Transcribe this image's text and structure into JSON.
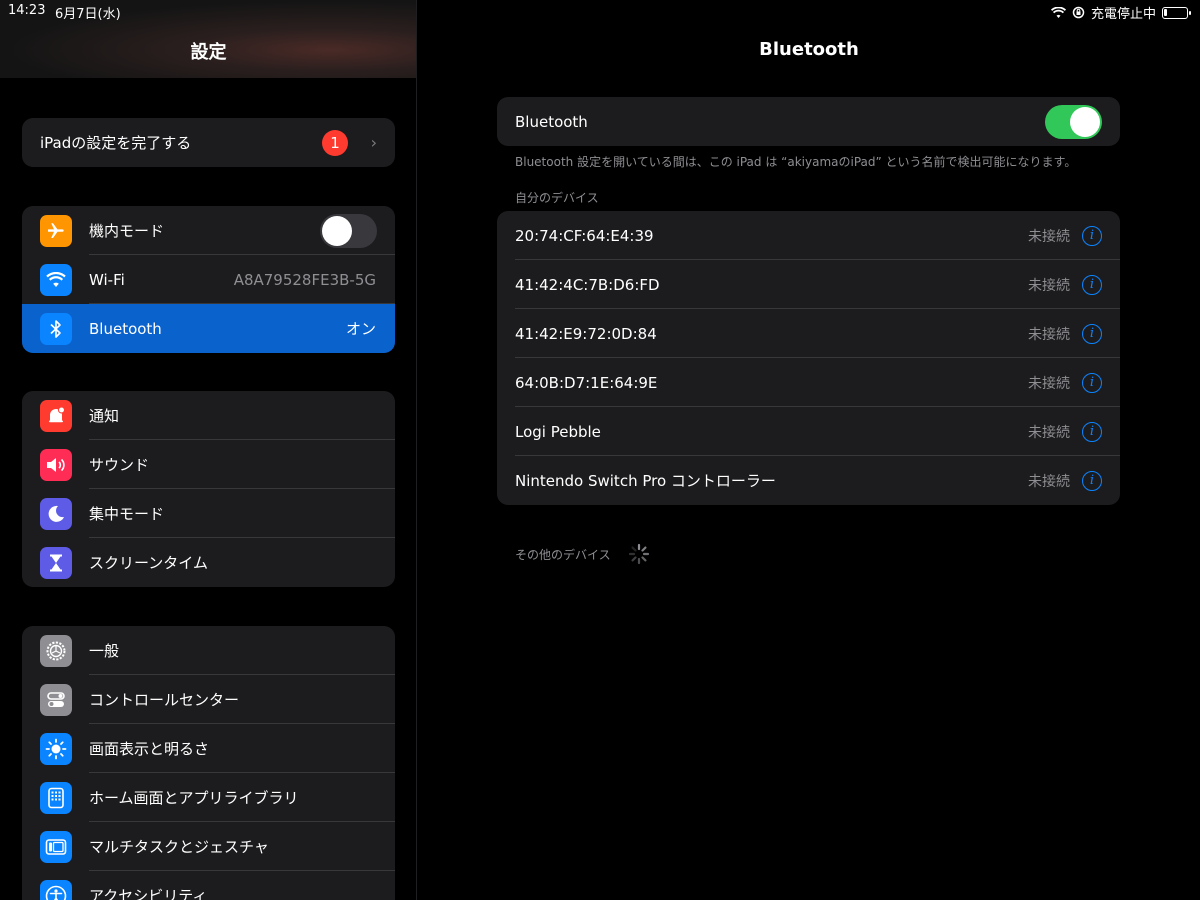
{
  "status_bar": {
    "time": "14:23",
    "date": "6月7日(水)",
    "charging_text": "充電停止中",
    "icons": [
      "wifi-icon",
      "lock-rotation-icon",
      "battery-icon"
    ]
  },
  "sidebar": {
    "title": "設定",
    "setup": {
      "label": "iPadの設定を完了する",
      "badge": "1"
    },
    "connectivity": [
      {
        "label": "機内モード",
        "icon": "airplane-icon",
        "icon_color": "#ff9500",
        "toggle": false
      },
      {
        "label": "Wi-Fi",
        "icon": "wifi-icon",
        "icon_color": "#0a84ff",
        "value": "A8A79528FE3B-5G"
      },
      {
        "label": "Bluetooth",
        "icon": "bluetooth-icon",
        "icon_color": "#0a84ff",
        "value": "オン",
        "selected": true
      }
    ],
    "notifications": [
      {
        "label": "通知",
        "icon": "bell-icon",
        "icon_color": "#ff3b30"
      },
      {
        "label": "サウンド",
        "icon": "speaker-icon",
        "icon_color": "#ff2d55"
      },
      {
        "label": "集中モード",
        "icon": "moon-icon",
        "icon_color": "#5e5ce6"
      },
      {
        "label": "スクリーンタイム",
        "icon": "hourglass-icon",
        "icon_color": "#5e5ce6"
      }
    ],
    "general": [
      {
        "label": "一般",
        "icon": "gear-icon",
        "icon_color": "#8e8e93"
      },
      {
        "label": "コントロールセンター",
        "icon": "switches-icon",
        "icon_color": "#8e8e93"
      },
      {
        "label": "画面表示と明るさ",
        "icon": "sun-icon",
        "icon_color": "#0a84ff"
      },
      {
        "label": "ホーム画面とアプリライブラリ",
        "icon": "home-grid-icon",
        "icon_color": "#0a84ff"
      },
      {
        "label": "マルチタスクとジェスチャ",
        "icon": "multitask-icon",
        "icon_color": "#0a84ff"
      },
      {
        "label": "アクセシビリティ",
        "icon": "accessibility-icon",
        "icon_color": "#0a84ff"
      }
    ]
  },
  "detail": {
    "title": "Bluetooth",
    "toggle_label": "Bluetooth",
    "toggle_on": true,
    "footnote": "Bluetooth 設定を開いている間は、この iPad は “akiyamaのiPad” という名前で検出可能になります。",
    "my_devices_header": "自分のデバイス",
    "devices": [
      {
        "name": "20:74:CF:64:E4:39",
        "status": "未接続"
      },
      {
        "name": "41:42:4C:7B:D6:FD",
        "status": "未接続"
      },
      {
        "name": "41:42:E9:72:0D:84",
        "status": "未接続"
      },
      {
        "name": "64:0B:D7:1E:64:9E",
        "status": "未接続"
      },
      {
        "name": "Logi Pebble",
        "status": "未接続"
      },
      {
        "name": "Nintendo Switch Pro コントローラー",
        "status": "未接続"
      }
    ],
    "other_devices_header": "その他のデバイス"
  }
}
